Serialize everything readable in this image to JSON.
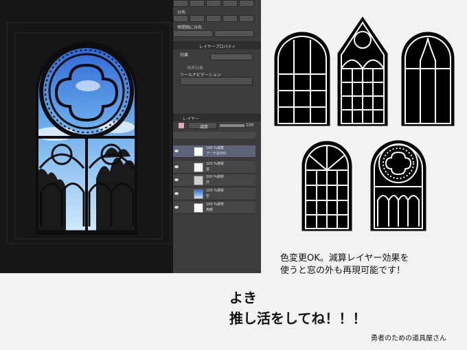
{
  "panel": {
    "section_distribute": "分布",
    "section_equal": "等間隔に分布",
    "tab_effect": "効果",
    "tab_layer_property": "レイヤープロパティ",
    "border_effect_label": "境界効果",
    "tool_navigation": "ツールナビゲーション",
    "layer_tab": "レイヤー",
    "blend_mode": "減算",
    "opacity_value": "100",
    "layers": [
      {
        "line1": "100 %減算",
        "line2": "アーチ窓005",
        "selected": true
      },
      {
        "line1": "100 %通常",
        "line2": "窓",
        "selected": false
      },
      {
        "line1": "100 %通常",
        "line2": "外",
        "selected": false
      },
      {
        "line1": "100 %通常",
        "line2": "空",
        "selected": false
      },
      {
        "line1": "100 %通常",
        "line2": "用紙",
        "selected": false
      }
    ]
  },
  "caption": {
    "line1": "色変更OK。減算レイヤー効果を",
    "line2": "使うと窓の外も再現可能です！"
  },
  "message": {
    "line1": "よき",
    "line2": "推し活をしてね！！！"
  },
  "signature": "勇者のための道具屋さん",
  "colors": {
    "sky_top": "#2f6fd8",
    "sky_bottom": "#cfe8fa",
    "panel_bg": "#3c3c3c",
    "selected_layer": "#5d6478"
  }
}
